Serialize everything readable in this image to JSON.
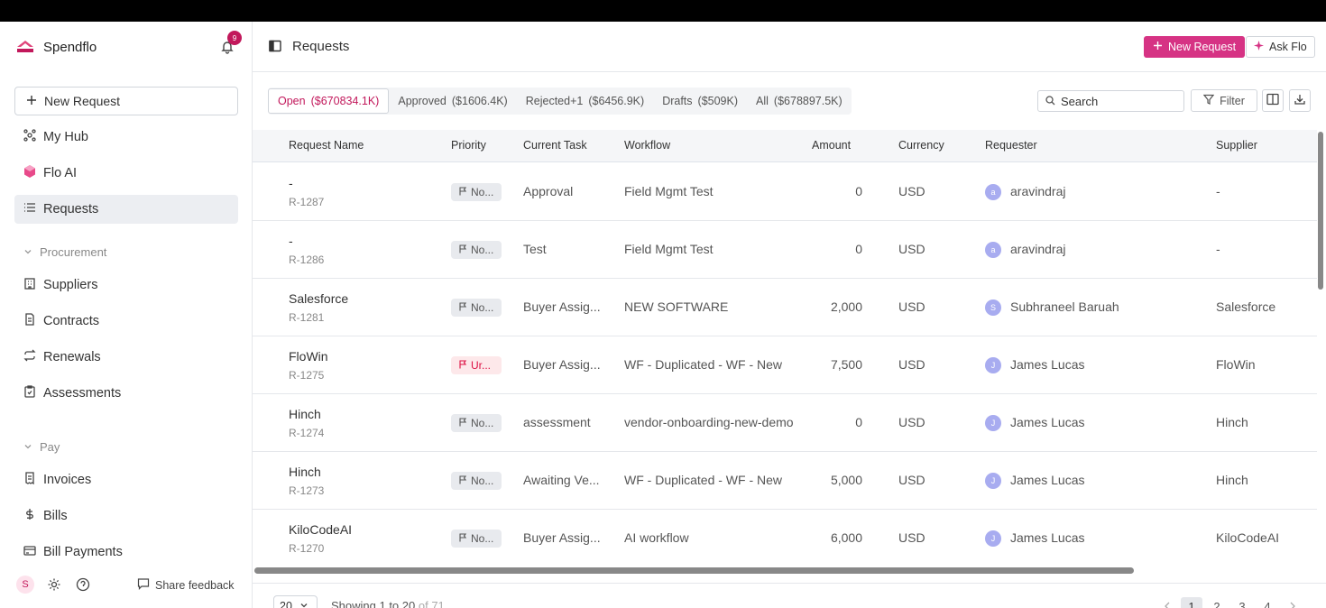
{
  "sidebar": {
    "brand": "Spendflo",
    "notifications_count": "9",
    "new_request_label": "New Request",
    "top_items": [
      {
        "label": "My Hub"
      },
      {
        "label": "Flo AI"
      },
      {
        "label": "Requests"
      }
    ],
    "procurement_label": "Procurement",
    "procurement_items": [
      {
        "label": "Suppliers"
      },
      {
        "label": "Contracts"
      },
      {
        "label": "Renewals"
      },
      {
        "label": "Assessments"
      }
    ],
    "pay_label": "Pay",
    "pay_items": [
      {
        "label": "Invoices"
      },
      {
        "label": "Bills"
      },
      {
        "label": "Bill Payments"
      }
    ],
    "user_initial": "S",
    "share_feedback": "Share feedback"
  },
  "header": {
    "title": "Requests",
    "new_request": "New Request",
    "ask_flo": "Ask Flo"
  },
  "tabs": [
    {
      "label": "Open",
      "count": "($670834.1K)"
    },
    {
      "label": "Approved",
      "count": "($1606.4K)"
    },
    {
      "label": "Rejected+1",
      "count": "($6456.9K)"
    },
    {
      "label": "Drafts",
      "count": "($509K)"
    },
    {
      "label": "All",
      "count": "($678897.5K)"
    }
  ],
  "toolbar": {
    "search_placeholder": "Search",
    "filter_label": "Filter"
  },
  "table": {
    "columns": [
      "Request Name",
      "Priority",
      "Current Task",
      "Workflow",
      "Amount",
      "Currency",
      "Requester",
      "Supplier"
    ],
    "rows": [
      {
        "name": "-",
        "id": "R-1287",
        "priority": "No...",
        "urgent": false,
        "task": "Approval",
        "workflow": "Field Mgmt Test",
        "amount": "0",
        "currency": "USD",
        "req_initial": "a",
        "requester": "aravindraj",
        "supplier": "-"
      },
      {
        "name": "-",
        "id": "R-1286",
        "priority": "No...",
        "urgent": false,
        "task": "Test",
        "workflow": "Field Mgmt Test",
        "amount": "0",
        "currency": "USD",
        "req_initial": "a",
        "requester": "aravindraj",
        "supplier": "-"
      },
      {
        "name": "Salesforce",
        "id": "R-1281",
        "priority": "No...",
        "urgent": false,
        "task": "Buyer Assig...",
        "workflow": "NEW SOFTWARE",
        "amount": "2,000",
        "currency": "USD",
        "req_initial": "S",
        "requester": "Subhraneel Baruah",
        "supplier": "Salesforce"
      },
      {
        "name": "FloWin",
        "id": "R-1275",
        "priority": "Ur...",
        "urgent": true,
        "task": "Buyer Assig...",
        "workflow": "WF - Duplicated - WF - New",
        "amount": "7,500",
        "currency": "USD",
        "req_initial": "J",
        "requester": "James Lucas",
        "supplier": "FloWin"
      },
      {
        "name": "Hinch",
        "id": "R-1274",
        "priority": "No...",
        "urgent": false,
        "task": "assessment",
        "workflow": "vendor-onboarding-new-demo",
        "amount": "0",
        "currency": "USD",
        "req_initial": "J",
        "requester": "James Lucas",
        "supplier": "Hinch"
      },
      {
        "name": "Hinch",
        "id": "R-1273",
        "priority": "No...",
        "urgent": false,
        "task": "Awaiting Ve...",
        "workflow": "WF - Duplicated - WF - New",
        "amount": "5,000",
        "currency": "USD",
        "req_initial": "J",
        "requester": "James Lucas",
        "supplier": "Hinch"
      },
      {
        "name": "KiloCodeAI",
        "id": "R-1270",
        "priority": "No...",
        "urgent": false,
        "task": "Buyer Assig...",
        "workflow": "AI workflow",
        "amount": "6,000",
        "currency": "USD",
        "req_initial": "J",
        "requester": "James Lucas",
        "supplier": "KiloCodeAI"
      }
    ]
  },
  "pager": {
    "page_size": "20",
    "showing": "Showing 1 to 20",
    "of_total": "of 71",
    "pages": [
      "1",
      "2",
      "3",
      "4"
    ]
  },
  "colors": {
    "accent": "#d63384",
    "urgent": "#dd1144",
    "avatar": "#a8acf0"
  }
}
